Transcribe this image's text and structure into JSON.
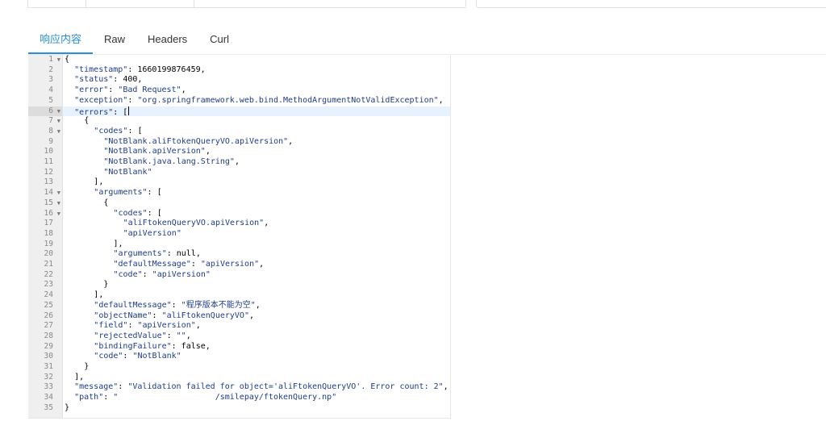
{
  "tabs": [
    {
      "label": "响应内容",
      "active": true
    },
    {
      "label": "Raw",
      "active": false
    },
    {
      "label": "Headers",
      "active": false
    },
    {
      "label": "Curl",
      "active": false
    }
  ],
  "editor": {
    "active_line": 6,
    "lines": [
      {
        "n": "1",
        "fold": true,
        "indent": 0,
        "parts": [
          [
            "p",
            "{"
          ]
        ]
      },
      {
        "n": "2",
        "fold": false,
        "indent": 1,
        "parts": [
          [
            "k",
            "\"timestamp\""
          ],
          [
            "p",
            ": "
          ],
          [
            "n",
            "1660199876459"
          ],
          [
            "p",
            ","
          ]
        ]
      },
      {
        "n": "3",
        "fold": false,
        "indent": 1,
        "parts": [
          [
            "k",
            "\"status\""
          ],
          [
            "p",
            ": "
          ],
          [
            "n",
            "400"
          ],
          [
            "p",
            ","
          ]
        ]
      },
      {
        "n": "4",
        "fold": false,
        "indent": 1,
        "parts": [
          [
            "k",
            "\"error\""
          ],
          [
            "p",
            ": "
          ],
          [
            "s",
            "\"Bad Request\""
          ],
          [
            "p",
            ","
          ]
        ]
      },
      {
        "n": "5",
        "fold": false,
        "indent": 1,
        "parts": [
          [
            "k",
            "\"exception\""
          ],
          [
            "p",
            ": "
          ],
          [
            "s",
            "\"org.springframework.web.bind.MethodArgumentNotValidException\""
          ],
          [
            "p",
            ","
          ]
        ]
      },
      {
        "n": "6",
        "fold": true,
        "indent": 1,
        "parts": [
          [
            "k",
            "\"errors\""
          ],
          [
            "p",
            ": ["
          ]
        ]
      },
      {
        "n": "7",
        "fold": true,
        "indent": 2,
        "parts": [
          [
            "p",
            "{"
          ]
        ]
      },
      {
        "n": "8",
        "fold": true,
        "indent": 3,
        "parts": [
          [
            "k",
            "\"codes\""
          ],
          [
            "p",
            ": ["
          ]
        ]
      },
      {
        "n": "9",
        "fold": false,
        "indent": 4,
        "parts": [
          [
            "s",
            "\"NotBlank.aliFtokenQueryVO.apiVersion\""
          ],
          [
            "p",
            ","
          ]
        ]
      },
      {
        "n": "10",
        "fold": false,
        "indent": 4,
        "parts": [
          [
            "s",
            "\"NotBlank.apiVersion\""
          ],
          [
            "p",
            ","
          ]
        ]
      },
      {
        "n": "11",
        "fold": false,
        "indent": 4,
        "parts": [
          [
            "s",
            "\"NotBlank.java.lang.String\""
          ],
          [
            "p",
            ","
          ]
        ]
      },
      {
        "n": "12",
        "fold": false,
        "indent": 4,
        "parts": [
          [
            "s",
            "\"NotBlank\""
          ]
        ]
      },
      {
        "n": "13",
        "fold": false,
        "indent": 3,
        "parts": [
          [
            "p",
            "],"
          ]
        ]
      },
      {
        "n": "14",
        "fold": true,
        "indent": 3,
        "parts": [
          [
            "k",
            "\"arguments\""
          ],
          [
            "p",
            ": ["
          ]
        ]
      },
      {
        "n": "15",
        "fold": true,
        "indent": 4,
        "parts": [
          [
            "p",
            "{"
          ]
        ]
      },
      {
        "n": "16",
        "fold": true,
        "indent": 5,
        "parts": [
          [
            "k",
            "\"codes\""
          ],
          [
            "p",
            ": ["
          ]
        ]
      },
      {
        "n": "17",
        "fold": false,
        "indent": 6,
        "parts": [
          [
            "s",
            "\"aliFtokenQueryVO.apiVersion\""
          ],
          [
            "p",
            ","
          ]
        ]
      },
      {
        "n": "18",
        "fold": false,
        "indent": 6,
        "parts": [
          [
            "s",
            "\"apiVersion\""
          ]
        ]
      },
      {
        "n": "19",
        "fold": false,
        "indent": 5,
        "parts": [
          [
            "p",
            "],"
          ]
        ]
      },
      {
        "n": "20",
        "fold": false,
        "indent": 5,
        "parts": [
          [
            "k",
            "\"arguments\""
          ],
          [
            "p",
            ": "
          ],
          [
            "w",
            "null"
          ],
          [
            "p",
            ","
          ]
        ]
      },
      {
        "n": "21",
        "fold": false,
        "indent": 5,
        "parts": [
          [
            "k",
            "\"defaultMessage\""
          ],
          [
            "p",
            ": "
          ],
          [
            "s",
            "\"apiVersion\""
          ],
          [
            "p",
            ","
          ]
        ]
      },
      {
        "n": "22",
        "fold": false,
        "indent": 5,
        "parts": [
          [
            "k",
            "\"code\""
          ],
          [
            "p",
            ": "
          ],
          [
            "s",
            "\"apiVersion\""
          ]
        ]
      },
      {
        "n": "23",
        "fold": false,
        "indent": 4,
        "parts": [
          [
            "p",
            "}"
          ]
        ]
      },
      {
        "n": "24",
        "fold": false,
        "indent": 3,
        "parts": [
          [
            "p",
            "],"
          ]
        ]
      },
      {
        "n": "25",
        "fold": false,
        "indent": 3,
        "parts": [
          [
            "k",
            "\"defaultMessage\""
          ],
          [
            "p",
            ": "
          ],
          [
            "s",
            "\"程序版本不能为空\""
          ],
          [
            "p",
            ","
          ]
        ]
      },
      {
        "n": "26",
        "fold": false,
        "indent": 3,
        "parts": [
          [
            "k",
            "\"objectName\""
          ],
          [
            "p",
            ": "
          ],
          [
            "s",
            "\"aliFtokenQueryVO\""
          ],
          [
            "p",
            ","
          ]
        ]
      },
      {
        "n": "27",
        "fold": false,
        "indent": 3,
        "parts": [
          [
            "k",
            "\"field\""
          ],
          [
            "p",
            ": "
          ],
          [
            "s",
            "\"apiVersion\""
          ],
          [
            "p",
            ","
          ]
        ]
      },
      {
        "n": "28",
        "fold": false,
        "indent": 3,
        "parts": [
          [
            "k",
            "\"rejectedValue\""
          ],
          [
            "p",
            ": "
          ],
          [
            "s",
            "\"\""
          ],
          [
            "p",
            ","
          ]
        ]
      },
      {
        "n": "29",
        "fold": false,
        "indent": 3,
        "parts": [
          [
            "k",
            "\"bindingFailure\""
          ],
          [
            "p",
            ": "
          ],
          [
            "w",
            "false"
          ],
          [
            "p",
            ","
          ]
        ]
      },
      {
        "n": "30",
        "fold": false,
        "indent": 3,
        "parts": [
          [
            "k",
            "\"code\""
          ],
          [
            "p",
            ": "
          ],
          [
            "s",
            "\"NotBlank\""
          ]
        ]
      },
      {
        "n": "31",
        "fold": false,
        "indent": 2,
        "parts": [
          [
            "p",
            "}"
          ]
        ]
      },
      {
        "n": "32",
        "fold": false,
        "indent": 1,
        "parts": [
          [
            "p",
            "],"
          ]
        ]
      },
      {
        "n": "33",
        "fold": false,
        "indent": 1,
        "parts": [
          [
            "k",
            "\"message\""
          ],
          [
            "p",
            ": "
          ],
          [
            "s",
            "\"Validation failed for object='aliFtokenQueryVO'. Error count: 2\""
          ],
          [
            "p",
            ","
          ]
        ]
      },
      {
        "n": "34",
        "fold": false,
        "indent": 1,
        "parts": [
          [
            "k",
            "\"path\""
          ],
          [
            "p",
            ": "
          ],
          [
            "s",
            "\"                    /smilepay/ftokenQuery.np\""
          ]
        ]
      },
      {
        "n": "35",
        "fold": false,
        "indent": 0,
        "parts": [
          [
            "p",
            "}"
          ]
        ]
      }
    ]
  }
}
